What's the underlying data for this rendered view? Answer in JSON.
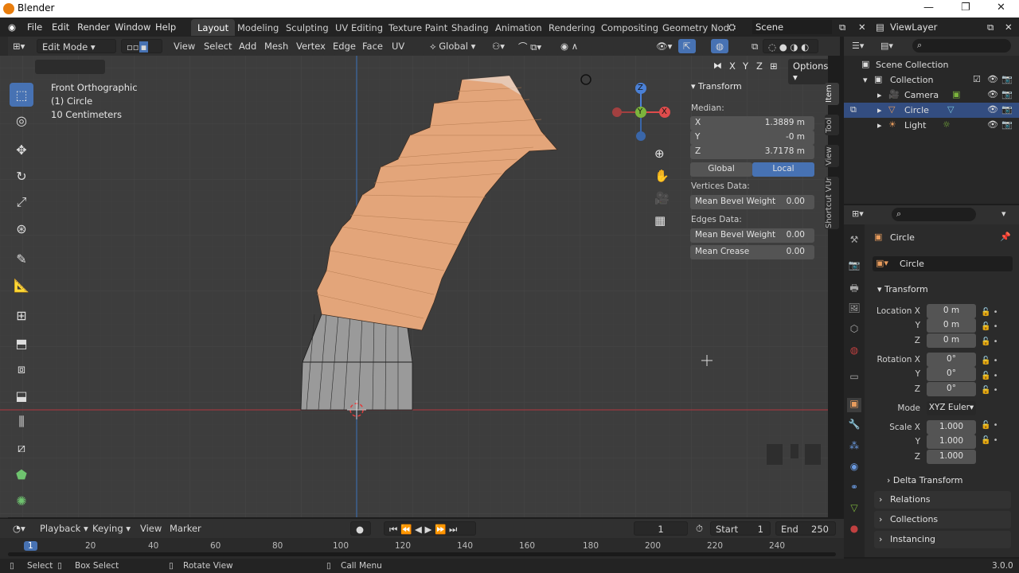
{
  "window": {
    "title": "Blender",
    "minimize": "—",
    "maximize": "❐",
    "close": "✕"
  },
  "menus": [
    "File",
    "Edit",
    "Render",
    "Window",
    "Help"
  ],
  "workspaces": [
    "Layout",
    "Modeling",
    "Sculpting",
    "UV Editing",
    "Texture Paint",
    "Shading",
    "Animation",
    "Rendering",
    "Compositing",
    "Geometry Nod"
  ],
  "scene": {
    "label": "Scene"
  },
  "viewlayer": {
    "label": "ViewLayer"
  },
  "viewport_header": {
    "mode": "Edit Mode",
    "menus": [
      "View",
      "Select",
      "Add",
      "Mesh",
      "Vertex",
      "Edge",
      "Face",
      "UV"
    ],
    "orientation": "Global",
    "options": "Options",
    "axes": [
      "X",
      "Y",
      "Z"
    ]
  },
  "overlay": {
    "view": "Front Orthographic",
    "object": "(1) Circle",
    "scale": "10 Centimeters"
  },
  "gizmo": {
    "x": "X",
    "y": "Y",
    "z": "Z"
  },
  "npanel": {
    "title": "Transform",
    "median": "Median:",
    "x_label": "X",
    "x_value": "1.3889 m",
    "y_label": "Y",
    "y_value": "-0 m",
    "z_label": "Z",
    "z_value": "3.7178 m",
    "global": "Global",
    "local": "Local",
    "vertices_data": "Vertices Data:",
    "mean_bevel_v": "Mean Bevel Weight",
    "mean_bevel_v_value": "0.00",
    "edges_data": "Edges Data:",
    "mean_bevel_e": "Mean Bevel Weight",
    "mean_bevel_e_value": "0.00",
    "mean_crease": "Mean Crease",
    "mean_crease_value": "0.00"
  },
  "side_tabs": [
    "Item",
    "Tool",
    "View",
    "Shortcut VUr"
  ],
  "outliner": {
    "root": "Scene Collection",
    "collection": "Collection",
    "items": [
      "Camera",
      "Circle",
      "Light"
    ]
  },
  "properties": {
    "object_name": "Circle",
    "data_name": "Circle",
    "transform": "Transform",
    "location_x_label": "Location X",
    "location_x": "0 m",
    "location_y_label": "Y",
    "location_y": "0 m",
    "location_z_label": "Z",
    "location_z": "0 m",
    "rotation_x_label": "Rotation X",
    "rotation_x": "0°",
    "rotation_y_label": "Y",
    "rotation_y": "0°",
    "rotation_z_label": "Z",
    "rotation_z": "0°",
    "mode_label": "Mode",
    "mode": "XYZ Euler",
    "scale_x_label": "Scale X",
    "scale_x": "1.000",
    "scale_y_label": "Y",
    "scale_y": "1.000",
    "scale_z_label": "Z",
    "scale_z": "1.000",
    "delta_transform": "Delta Transform",
    "relations": "Relations",
    "collections": "Collections",
    "instancing": "Instancing"
  },
  "timeline": {
    "playback": "Playback",
    "keying": "Keying",
    "view": "View",
    "marker": "Marker",
    "current_frame": "1",
    "start_label": "Start",
    "start": "1",
    "end_label": "End",
    "end": "250",
    "ticks": [
      "1",
      "20",
      "40",
      "60",
      "80",
      "100",
      "120",
      "140",
      "160",
      "180",
      "200",
      "220",
      "240"
    ]
  },
  "statusbar": {
    "select": "Select",
    "box_select": "Box Select",
    "rotate_view": "Rotate View",
    "call_menu": "Call Menu",
    "version": "3.0.0"
  },
  "colors": {
    "accent": "#4772b3",
    "mesh_selected": "#e8a477",
    "orange": "#e87d0d"
  }
}
